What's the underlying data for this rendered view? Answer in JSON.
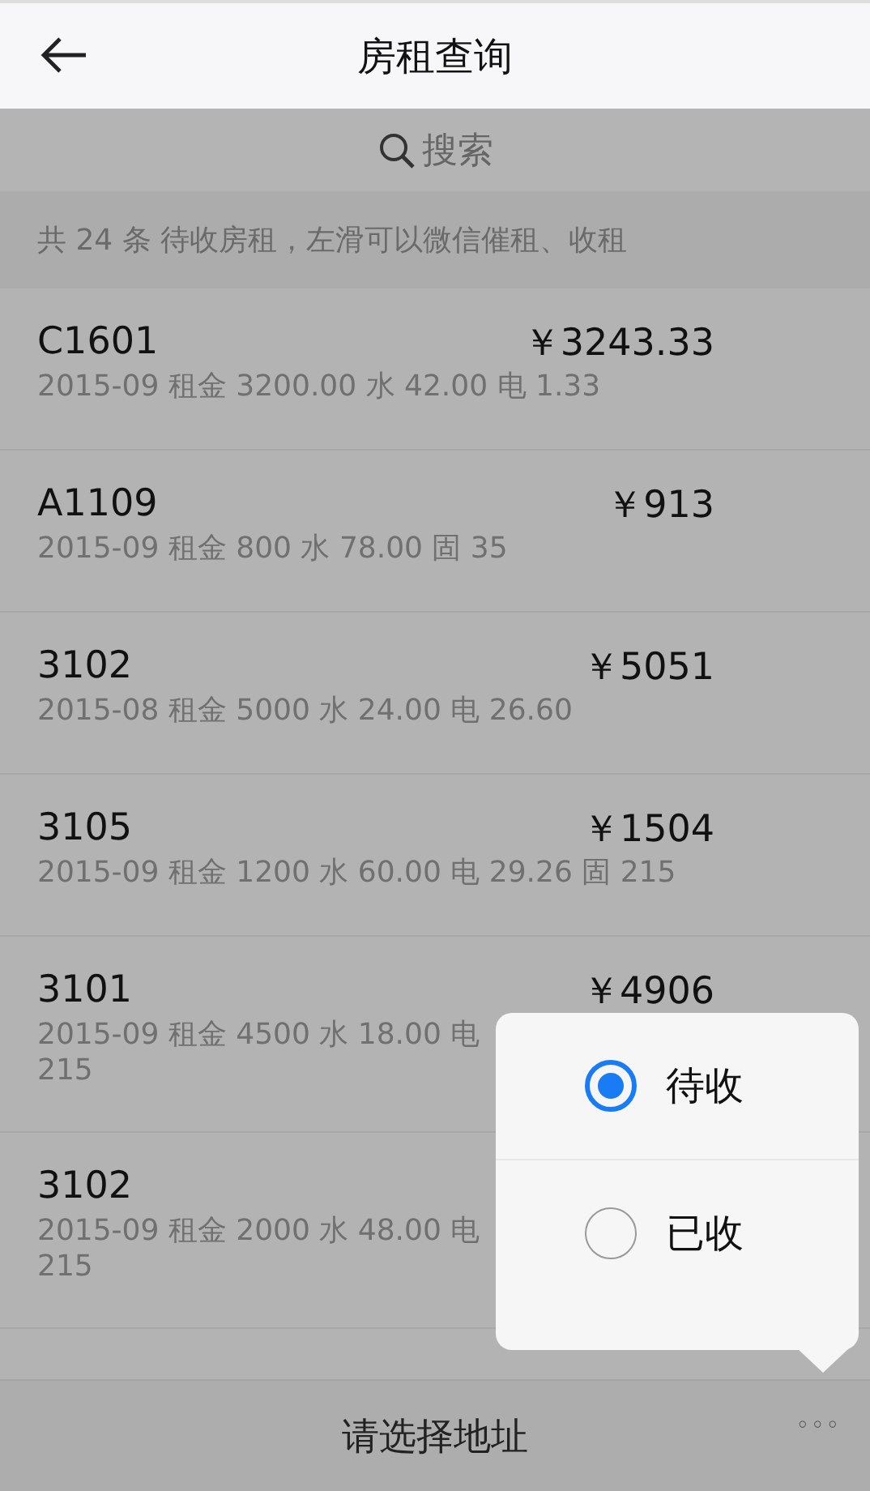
{
  "header": {
    "title": "房租查询"
  },
  "search": {
    "placeholder": "搜索"
  },
  "info": "共 24 条 待收房租，左滑可以微信催租、收租",
  "rows": [
    {
      "room": "C1601",
      "amount": "￥3243.33",
      "detail": [
        "2015-09 租金 3200.00 水 42.00 电 1.33"
      ]
    },
    {
      "room": "A1109",
      "amount": "￥913",
      "detail": [
        "2015-09 租金 800 水 78.00 固 35"
      ]
    },
    {
      "room": "3102",
      "amount": "￥5051",
      "detail": [
        "2015-08 租金 5000 水 24.00 电 26.60"
      ]
    },
    {
      "room": "3105",
      "amount": "￥1504",
      "detail": [
        "2015-09 租金 1200 水 60.00 电 29.26 固 215"
      ]
    },
    {
      "room": "3101",
      "amount": "￥4906",
      "detail": [
        "2015-09 租金 4500 水 18.00 电",
        "215"
      ]
    },
    {
      "room": "3102",
      "detail": [
        "2015-09 租金 2000 水 48.00 电",
        "215"
      ]
    }
  ],
  "popup": {
    "options": [
      {
        "label": "待收",
        "selected": true
      },
      {
        "label": "已收",
        "selected": false
      }
    ]
  },
  "bottom_bar": {
    "address": "请选择地址",
    "more": "◦◦◦"
  }
}
